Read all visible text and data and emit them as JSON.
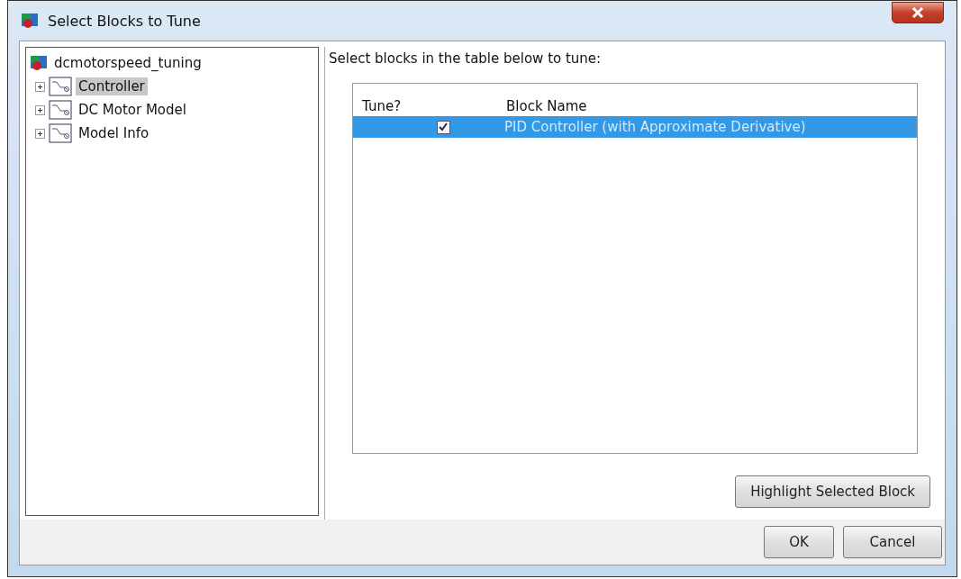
{
  "window": {
    "title": "Select Blocks to Tune"
  },
  "tree": {
    "label": "dcmotorspeed_tuning",
    "children": [
      {
        "label": "Controller",
        "selected": true,
        "expanded": false
      },
      {
        "label": "DC Motor Model",
        "selected": false,
        "expanded": false
      },
      {
        "label": "Model Info",
        "selected": false,
        "expanded": false
      }
    ]
  },
  "instruction": "Select blocks in the table below to tune:",
  "table": {
    "columns": [
      "Tune?",
      "Block Name"
    ],
    "rows": [
      {
        "tune": true,
        "block_name": "PID Controller (with Approximate Derivative)",
        "selected": true
      }
    ]
  },
  "highlight_button": "Highlight Selected Block",
  "buttons": [
    "OK",
    "Cancel"
  ]
}
